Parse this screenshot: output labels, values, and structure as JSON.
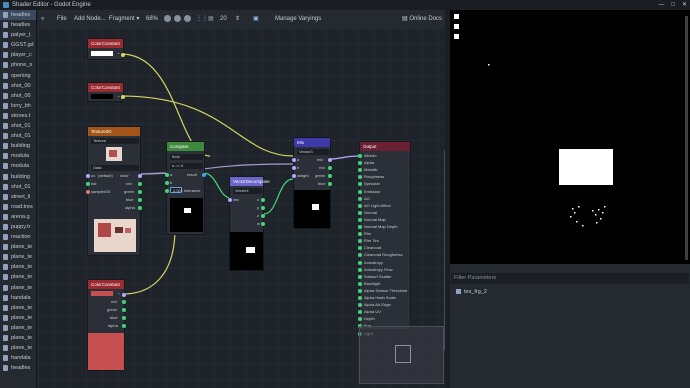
{
  "window": {
    "title": "Shader Editor - Godot Engine",
    "controls": [
      "—",
      "□",
      "✕"
    ]
  },
  "files": [
    {
      "label": "headles"
    },
    {
      "label": "headles"
    },
    {
      "label": "palyer_t"
    },
    {
      "label": "GGST.gd"
    },
    {
      "label": "player_c"
    },
    {
      "label": "phone_s"
    },
    {
      "label": "opening"
    },
    {
      "label": "shot_00"
    },
    {
      "label": "shot_00"
    },
    {
      "label": "lorry_bh"
    },
    {
      "label": "stones.t"
    },
    {
      "label": "shot_01"
    },
    {
      "label": "shot_01"
    },
    {
      "label": "building"
    },
    {
      "label": "modula"
    },
    {
      "label": "modula"
    },
    {
      "label": "building"
    },
    {
      "label": "shot_01"
    },
    {
      "label": "street_li"
    },
    {
      "label": "road.tres"
    },
    {
      "label": "arena.g"
    },
    {
      "label": "puppy.tr"
    },
    {
      "label": "reaction"
    },
    {
      "label": "plane_te"
    },
    {
      "label": "plane_te"
    },
    {
      "label": "plane_te"
    },
    {
      "label": "plane_te"
    },
    {
      "label": "plane_te"
    },
    {
      "label": "handala"
    },
    {
      "label": "plane_te"
    },
    {
      "label": "plane_te"
    },
    {
      "label": "plane_te"
    },
    {
      "label": "plane_te"
    },
    {
      "label": "plane_te"
    },
    {
      "label": "handala"
    },
    {
      "label": "headles"
    }
  ],
  "toolbar": {
    "file": "File",
    "add_node": "Add Node...",
    "mode": "Fragment",
    "zoom": "68%",
    "snap": "20",
    "manage": "Manage Varyings",
    "docs": "Online Docs"
  },
  "nodes": {
    "color1": {
      "title": "ColorConstant"
    },
    "color2": {
      "title": "ColorConstant"
    },
    "color3": {
      "title": "ColorConstant",
      "ports": [
        "rgb",
        "red",
        "green",
        "blue",
        "alpha"
      ]
    },
    "texture": {
      "title": "Texture2D",
      "source": "Texture",
      "filter": "Data",
      "inputs": [
        "uv",
        "lod",
        "sampler2D"
      ],
      "input_value": "(default)",
      "outputs": [
        "color",
        "red",
        "green",
        "blue",
        "alpha"
      ]
    },
    "compare": {
      "title": "Compare",
      "type": "float",
      "op": "a == b",
      "inputs": [
        "a",
        "b",
        "tolerance"
      ],
      "b_value": "0.001",
      "output": "result"
    },
    "decompose": {
      "title": "VectorDecompose",
      "type": "Vector4",
      "input": "vec",
      "outputs": [
        "x",
        "y",
        "z",
        "w"
      ]
    },
    "mix": {
      "title": "Mix",
      "type": "Vector3",
      "inputs": [
        "a",
        "b",
        "weight"
      ],
      "outputs": [
        "mix",
        "red",
        "green",
        "blue"
      ]
    },
    "output": {
      "title": "Output",
      "ports": [
        "Albedo",
        "Alpha",
        "Metallic",
        "Roughness",
        "Specular",
        "Emission",
        "AO",
        "AO Light Affect",
        "Normal",
        "Normal Map",
        "Normal Map Depth",
        "Rim",
        "Rim Tint",
        "Clearcoat",
        "Clearcoat Roughness",
        "Anisotropy",
        "Anisotropy Flow",
        "Subsurf Scatter",
        "Backlight",
        "Alpha Scissor Threshold",
        "Alpha Hash Scale",
        "Alpha AA Edge",
        "Alpha UV",
        "Depth",
        "Fog",
        "Light"
      ]
    }
  },
  "filter_panel": {
    "placeholder": "Filter Parameters",
    "items": [
      {
        "label": "tex_frg_2"
      }
    ]
  },
  "colors": {
    "red_header": "#9b2a30",
    "texture_header": "#a35418",
    "compare_header": "#3d8a3d",
    "decompose_header": "#6b66cc",
    "mix_header": "#3d39a8",
    "output_header": "#6b2033",
    "wire_yellow": "#d7d560",
    "wire_purple": "#a69ccf",
    "port_green": "#42d679",
    "port_blue": "#3d9ff5",
    "port_purple": "#b5a6ff",
    "swatch_red": "#c84f4f"
  }
}
